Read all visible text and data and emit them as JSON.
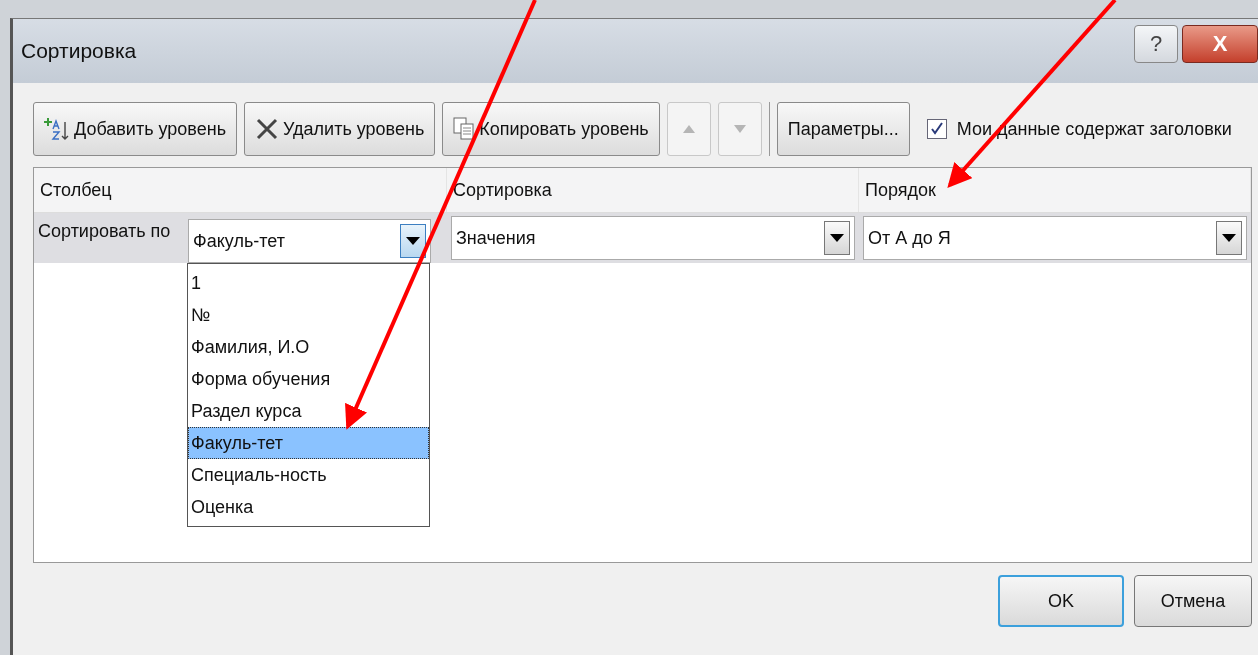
{
  "window": {
    "title": "Сортировка",
    "help_button": "?",
    "close_button": "X"
  },
  "toolbar": {
    "buttons": [
      {
        "label": "Добавить уровень",
        "kind": "add",
        "disabled": false
      },
      {
        "label": "Удалить уровень",
        "kind": "delete",
        "disabled": false
      },
      {
        "label": "Копировать уровень",
        "kind": "copy",
        "disabled": false
      },
      {
        "kind": "up",
        "disabled": true
      },
      {
        "kind": "down",
        "disabled": true
      },
      {
        "label": "Параметры...",
        "kind": "text",
        "disabled": false
      }
    ],
    "checkbox": {
      "label": "Мои данные содержат заголовки",
      "checked": true
    }
  },
  "table": {
    "columns": [
      "Столбец",
      "Сортировка",
      "Порядок"
    ],
    "rows": [
      {
        "label": "Сортировать по",
        "column": "Факуль-тет",
        "sort_on": "Значения",
        "order": "От А до Я",
        "selected": true
      }
    ]
  },
  "dropdown": {
    "items": [
      {
        "label": "1",
        "selected": false
      },
      {
        "label": "№",
        "selected": false
      },
      {
        "label": "Фамилия, И.О",
        "selected": false
      },
      {
        "label": "Форма обучения",
        "selected": false
      },
      {
        "label": "Раздел курса",
        "selected": false
      },
      {
        "label": "Факуль-тет",
        "selected": true
      },
      {
        "label": "Специаль-ность",
        "selected": false
      },
      {
        "label": "Оценка",
        "selected": false
      }
    ]
  },
  "footer": {
    "buttons": [
      {
        "label": "OK",
        "default": true
      },
      {
        "label": "Отмена",
        "default": false
      }
    ]
  }
}
